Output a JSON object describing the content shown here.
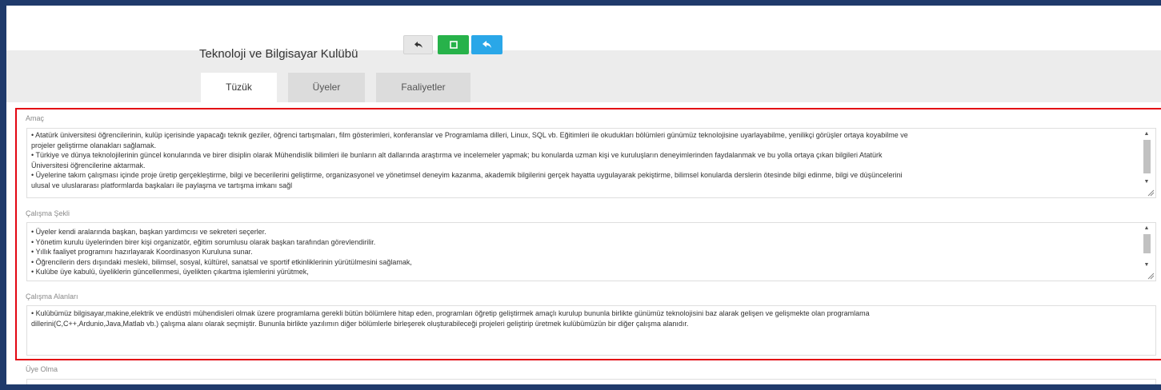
{
  "header": {
    "club_title": "Teknoloji ve Bilgisayar Kulübü",
    "buttons": [
      {
        "name": "back",
        "icon": "reply-arrow-icon",
        "color": "#e6e6e6"
      },
      {
        "name": "square",
        "icon": "square-icon",
        "color": "#27b24a"
      },
      {
        "name": "share",
        "icon": "share-arrow-icon",
        "color": "#2aa7e8"
      }
    ]
  },
  "tabs": [
    {
      "label": "Tüzük",
      "active": true
    },
    {
      "label": "Üyeler",
      "active": false
    },
    {
      "label": "Faaliyetler",
      "active": false
    }
  ],
  "sections": {
    "amac": {
      "label": "Amaç",
      "lines": [
        "•     Atatürk üniversitesi öğrencilerinin, kulüp içerisinde yapacağı teknik geziler, öğrenci tartışmaları, film gösterimleri, konferanslar ve Programlama dilleri, Linux, SQL vb. Eğitimleri ile okudukları bölümleri günümüz teknolojisine uyarlayabilme, yenilikçi görüşler ortaya koyabilme ve",
        "projeler geliştirme olanakları sağlamak.",
        "•     Türkiye ve dünya teknolojilerinin güncel konularında ve birer disiplin olarak Mühendislik bilimleri ile bunların alt dallarında araştırma ve incelemeler yapmak; bu konularda uzman kişi ve kuruluşların deneyimlerinden faydalanmak ve bu yolla ortaya çıkan bilgileri Atatürk",
        "Üniversitesi öğrencilerine aktarmak.",
        "•     Üyelerine takım çalışması içinde proje üretip gerçekleştirme, bilgi ve becerilerini geliştirme, organizasyonel ve yönetimsel deneyim kazanma, akademik bilgilerini gerçek hayatta uygulayarak pekiştirme, bilimsel konularda derslerin ötesinde bilgi edinme, bilgi ve düşüncelerini",
        "ulusal ve uluslararası platformlarda başkaları ile paylaşma ve tartışma imkanı sağl"
      ]
    },
    "calisma_sekli": {
      "label": "Çalışma Şekli",
      "lines": [
        "•     Üyeler kendi aralarında başkan, başkan yardımcısı ve sekreteri seçerler.",
        "•     Yönetim kurulu üyelerinden birer kişi organizatör, eğitim sorumlusu olarak başkan tarafından görevlendirilir.",
        "•     Yıllık faaliyet programını hazırlayarak Koordinasyon Kuruluna sunar.",
        "•     Öğrencilerin ders dışındaki mesleki, bilimsel, sosyal, kültürel, sanatsal ve sportif etkinliklerinin yürütülmesini sağlamak,",
        "•     Kulübe üye kabulü, üyeliklerin güncellenmesi, üyelikten çıkartma işlemlerini yürütmek,"
      ]
    },
    "calisma_alanlari": {
      "label": "Çalışma Alanları",
      "lines": [
        "•     Kulübümüz bilgisayar,makine,elektrik ve endüstri mühendisleri olmak üzere programlama gerekli bütün bölümlere hitap eden, programları öğretip geliştirmek amaçlı kurulup bununla birlikte günümüz teknolojisini baz alarak gelişen ve gelişmekte olan programlama",
        "dillerini(C,C++,Ardunio,Java,Matlab vb.) çalışma alanı olarak seçmiştir. Bununla birlikte yazılımın diğer bölümlerle birleşerek oluşturabileceği projeleri geliştirip üretmek kulübümüzün bir diğer çalışma alanıdır."
      ]
    },
    "uye_olma": {
      "label": "Üye Olma"
    }
  },
  "colors": {
    "highlight_frame": "#e30613",
    "outer_frame": "#1f3a6b",
    "green_button": "#27b24a",
    "blue_button": "#2aa7e8"
  }
}
